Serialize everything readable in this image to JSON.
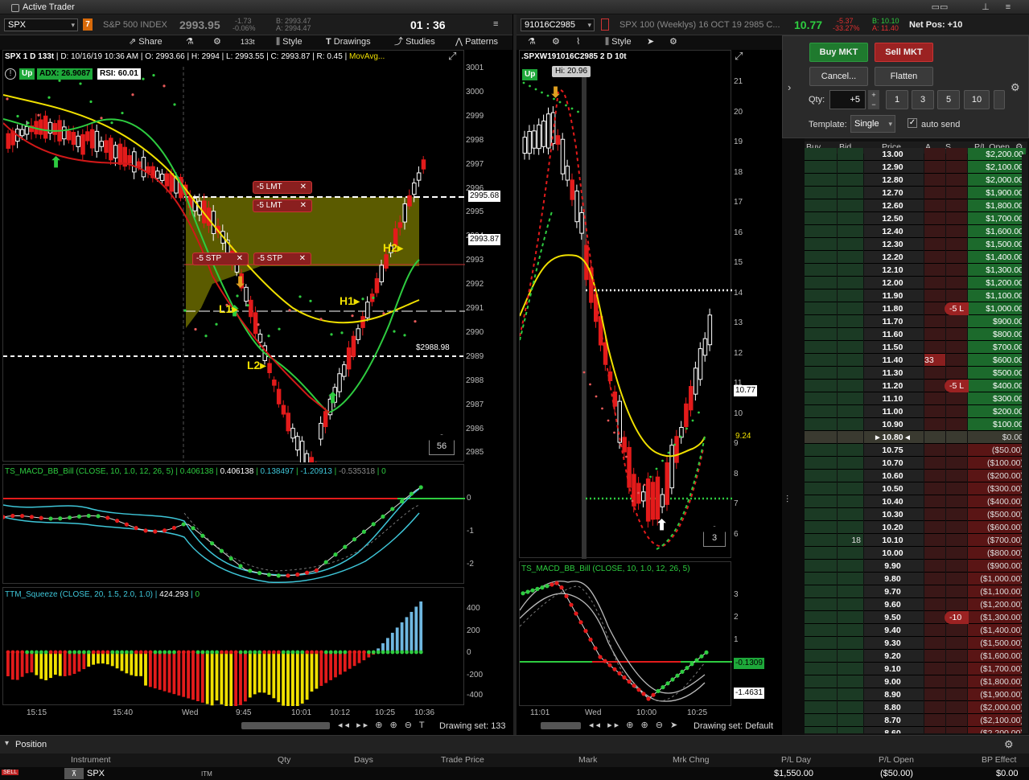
{
  "window": {
    "title": "Active Trader"
  },
  "left": {
    "symbol": "SPX",
    "badge": "7",
    "desc": "S&P 500 INDEX",
    "last": "2993.95",
    "chg": "-1.73",
    "pct": "-0.06%",
    "bid": "B: 2993.47",
    "ask": "A: 2994.47",
    "time": "01 : 36",
    "toolbar": {
      "share": "Share",
      "ticks": "133t",
      "style": "Style",
      "drawings": "Drawings",
      "studies": "Studies",
      "patterns": "Patterns"
    },
    "header": {
      "name": "SPX 1 D 133t",
      "date": "D: 10/16/19 10:36 AM",
      "o": "O: 2993.66",
      "h": "H: 2994",
      "l": "L: 2993.55",
      "c": "C: 2993.87",
      "r": "R: 0.45",
      "study": "MovAvg..."
    },
    "labels": {
      "up": "Up",
      "adx": "ADX: 26.9087",
      "rsi": "RSI: 60.01"
    },
    "orders": {
      "lmt1": "-5 LMT",
      "lmt2": "-5 LMT",
      "stp1": "-5 STP",
      "stp2": "-5 STP"
    },
    "tags": {
      "h1": "H1",
      "h2": "H2",
      "l1": "L1",
      "l2": "L2",
      "price_line": "$2988.98",
      "price_hi": "2995.68",
      "price_last": "2993.87",
      "count": "56"
    },
    "prices": [
      "3001",
      "3000",
      "2999",
      "2998",
      "2997",
      "2996",
      "2995",
      "2994",
      "2993",
      "2992",
      "2991",
      "2990",
      "2989",
      "2988",
      "2987",
      "2986",
      "2985"
    ],
    "macd": {
      "title": "TS_MACD_BB_Bill (CLOSE, 10, 1.0, 12, 26, 5)",
      "v1": "0.406138",
      "v2": "0.406138",
      "v3": "0.138497",
      "v4": "-1.20913",
      "v5": "-0.535318",
      "v6": "0",
      "scale": [
        "0",
        "-1",
        "-2"
      ]
    },
    "ttm": {
      "title": "TTM_Squeeze (CLOSE, 20, 1.5, 2.0, 1.0)",
      "v1": "424.293",
      "v2": "0",
      "scale": [
        "400",
        "200",
        "0",
        "-200",
        "-400"
      ]
    },
    "xaxis": [
      "15:15",
      "15:40",
      "Wed",
      "9:45",
      "10:01",
      "10:12",
      "10:25",
      "10:36"
    ],
    "drawing_set": "Drawing set: 133"
  },
  "right": {
    "symbol": "91016C2985",
    "desc": "SPX 100 (Weeklys) 16 OCT 19 2985 C...",
    "last": "10.77",
    "chg": "-5.37",
    "pct": "-33.27%",
    "bid": "B: 10.10",
    "ask": "A: 11.40",
    "netpos": "Net Pos: +10",
    "toolbar": {
      "style": "Style"
    },
    "header": {
      "name": ".SPXW191016C2985 2 D 10t"
    },
    "labels": {
      "up": "Up",
      "hi": "Hi: 20.96",
      "last": "10.77",
      "ma": "9.24",
      "count": "3"
    },
    "prices": [
      "21",
      "20",
      "19",
      "18",
      "17",
      "16",
      "15",
      "14",
      "13",
      "12",
      "11",
      "10",
      "9",
      "8",
      "7",
      "6"
    ],
    "macd": {
      "title": "TS_MACD_BB_Bill (CLOSE, 10, 1.0, 12, 26, 5)",
      "scale": [
        "3",
        "2",
        "1",
        "0",
        "-1"
      ],
      "v_hi": "-0.1309",
      "v_lo": "-1.4631"
    },
    "xaxis": [
      "11:01",
      "Wed",
      "10:00",
      "10:25"
    ],
    "drawing_set": "Drawing set: Default"
  },
  "order_entry": {
    "buy": "Buy MKT",
    "sell": "Sell MKT",
    "cancel": "Cancel...",
    "flatten": "Flatten",
    "qty_label": "Qty:",
    "qty": "+5",
    "q1": "1",
    "q3": "3",
    "q5": "5",
    "q10": "10",
    "template_label": "Template:",
    "template": "Single",
    "autosend": "auto send"
  },
  "ladder": {
    "headers": {
      "buy": "Buy ...",
      "bid": "Bid ...",
      "price": "Price",
      "ask": "A...",
      "sell": "S...",
      "pl": "P/L Open"
    },
    "rows": [
      {
        "p": "13.00",
        "pl": "$2,200.00"
      },
      {
        "p": "12.90",
        "pl": "$2,100.00"
      },
      {
        "p": "12.80",
        "pl": "$2,000.00"
      },
      {
        "p": "12.70",
        "pl": "$1,900.00"
      },
      {
        "p": "12.60",
        "pl": "$1,800.00"
      },
      {
        "p": "12.50",
        "pl": "$1,700.00"
      },
      {
        "p": "12.40",
        "pl": "$1,600.00"
      },
      {
        "p": "12.30",
        "pl": "$1,500.00"
      },
      {
        "p": "12.20",
        "pl": "$1,400.00"
      },
      {
        "p": "12.10",
        "pl": "$1,300.00"
      },
      {
        "p": "12.00",
        "pl": "$1,200.00"
      },
      {
        "p": "11.90",
        "pl": "$1,100.00"
      },
      {
        "p": "11.80",
        "pl": "$1,000.00",
        "sell": "-5 L"
      },
      {
        "p": "11.70",
        "pl": "$900.00"
      },
      {
        "p": "11.60",
        "pl": "$800.00"
      },
      {
        "p": "11.50",
        "pl": "$700.00"
      },
      {
        "p": "11.40",
        "pl": "$600.00",
        "ask": "33"
      },
      {
        "p": "11.30",
        "pl": "$500.00"
      },
      {
        "p": "11.20",
        "pl": "$400.00",
        "sell": "-5 L"
      },
      {
        "p": "11.10",
        "pl": "$300.00"
      },
      {
        "p": "11.00",
        "pl": "$200.00"
      },
      {
        "p": "10.90",
        "pl": "$100.00"
      },
      {
        "p": "10.80",
        "pl": "$0.00",
        "current": true
      },
      {
        "p": "10.75",
        "pl": "($50.00)"
      },
      {
        "p": "10.70",
        "pl": "($100.00)"
      },
      {
        "p": "10.60",
        "pl": "($200.00)"
      },
      {
        "p": "10.50",
        "pl": "($300.00)"
      },
      {
        "p": "10.40",
        "pl": "($400.00)"
      },
      {
        "p": "10.30",
        "pl": "($500.00)"
      },
      {
        "p": "10.20",
        "pl": "($600.00)"
      },
      {
        "p": "10.10",
        "pl": "($700.00)",
        "bid": "18"
      },
      {
        "p": "10.00",
        "pl": "($800.00)"
      },
      {
        "p": "9.90",
        "pl": "($900.00)"
      },
      {
        "p": "9.80",
        "pl": "($1,000.00)"
      },
      {
        "p": "9.70",
        "pl": "($1,100.00)"
      },
      {
        "p": "9.60",
        "pl": "($1,200.00)"
      },
      {
        "p": "9.50",
        "pl": "($1,300.00)",
        "sell": "-10"
      },
      {
        "p": "9.40",
        "pl": "($1,400.00)"
      },
      {
        "p": "9.30",
        "pl": "($1,500.00)"
      },
      {
        "p": "9.20",
        "pl": "($1,600.00)"
      },
      {
        "p": "9.10",
        "pl": "($1,700.00)"
      },
      {
        "p": "9.00",
        "pl": "($1,800.00)"
      },
      {
        "p": "8.90",
        "pl": "($1,900.00)"
      },
      {
        "p": "8.80",
        "pl": "($2,000.00)"
      },
      {
        "p": "8.70",
        "pl": "($2,100.00)"
      },
      {
        "p": "8.60",
        "pl": "($2,200.00)"
      }
    ]
  },
  "position": {
    "title": "Position",
    "headers": [
      "Instrument",
      "Qty",
      "Days",
      "Trade Price",
      "Mark",
      "Mrk Chng",
      "P/L Day",
      "P/L Open",
      "BP Effect"
    ],
    "row": {
      "badge": "SELL",
      "instrument": "SPX",
      "itm": "ITM",
      "pl_day": "$1,550.00",
      "pl_open": "($50.00)",
      "bp": "$0.00"
    }
  },
  "colors": {
    "up": "#2ecc40",
    "down": "#e31b1b",
    "yellow": "#f0e000",
    "cyan": "#3ec6d8",
    "olive": "#6b6b00",
    "buy": "#1f7a2e",
    "sell": "#9b2222"
  }
}
